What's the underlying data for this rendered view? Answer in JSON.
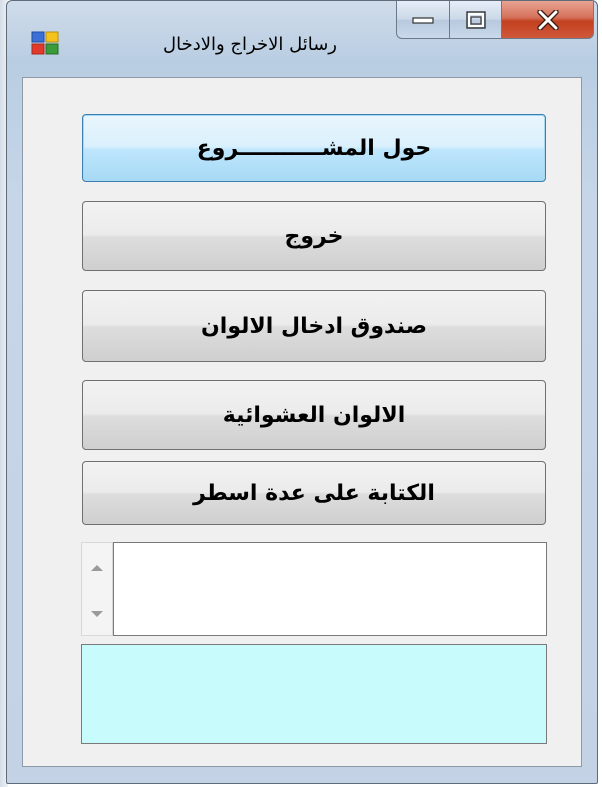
{
  "window": {
    "title": "رسائل الاخراج والادخال"
  },
  "buttons": {
    "about_project": "حول المشـــــــــــروع",
    "exit": "خروج",
    "color_input_box": "صندوق ادخال الالوان",
    "random_colors": "الالوان العشوائية",
    "multiline_writing": "الكتابة على عدة اسطر"
  },
  "input": {
    "value": ""
  },
  "colors": {
    "color_panel": "#c8fcfc",
    "close_button": "#c2401f",
    "focused_button_border": "#3c7fb1"
  },
  "icons": {
    "app": "windows-form-icon",
    "minimize": "minimize-icon",
    "maximize": "maximize-icon",
    "close": "close-icon",
    "spin_up": "arrow-up-icon",
    "spin_down": "arrow-down-icon"
  }
}
